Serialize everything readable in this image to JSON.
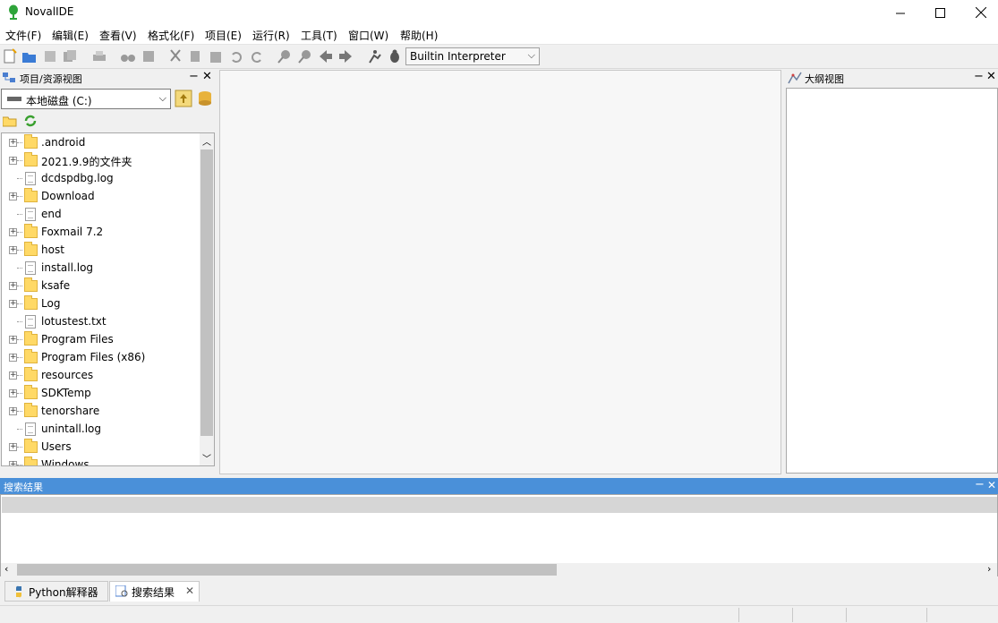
{
  "window": {
    "title": "NovalIDE"
  },
  "menu": [
    "文件(F)",
    "编辑(E)",
    "查看(V)",
    "格式化(F)",
    "项目(E)",
    "运行(R)",
    "工具(T)",
    "窗口(W)",
    "帮助(H)"
  ],
  "toolbar": {
    "interpreter": "Builtin Interpreter",
    "icons": [
      "new-file",
      "open-file",
      "save",
      "save-all",
      "print",
      "find",
      "find-in-files",
      "cut",
      "copy",
      "paste",
      "undo",
      "redo",
      "zoom-in",
      "zoom-out",
      "back",
      "forward",
      "run",
      "debug"
    ]
  },
  "left_panel": {
    "title": "项目/资源视图",
    "drive": "本地磁盘 (C:)",
    "tree": [
      {
        "label": ".android",
        "type": "folder"
      },
      {
        "label": "2021.9.9的文件夹",
        "type": "folder"
      },
      {
        "label": "dcdspdbg.log",
        "type": "file"
      },
      {
        "label": "Download",
        "type": "folder"
      },
      {
        "label": "end",
        "type": "file"
      },
      {
        "label": "Foxmail 7.2",
        "type": "folder"
      },
      {
        "label": "host",
        "type": "folder"
      },
      {
        "label": "install.log",
        "type": "file"
      },
      {
        "label": "ksafe",
        "type": "folder"
      },
      {
        "label": "Log",
        "type": "folder"
      },
      {
        "label": "lotustest.txt",
        "type": "file"
      },
      {
        "label": "Program Files",
        "type": "folder"
      },
      {
        "label": "Program Files (x86)",
        "type": "folder"
      },
      {
        "label": "resources",
        "type": "folder"
      },
      {
        "label": "SDKTemp",
        "type": "folder"
      },
      {
        "label": "tenorshare",
        "type": "folder"
      },
      {
        "label": "unintall.log",
        "type": "file"
      },
      {
        "label": "Users",
        "type": "folder"
      },
      {
        "label": "Windows",
        "type": "folder"
      }
    ]
  },
  "right_panel": {
    "title": "大纲视图"
  },
  "search_panel": {
    "title": "搜索结果"
  },
  "bottom_tabs": [
    {
      "label": "Python解释器",
      "active": false
    },
    {
      "label": "搜索结果",
      "active": true
    }
  ],
  "colors": {
    "accent": "#4a90d9",
    "folder": "#ffd966"
  }
}
